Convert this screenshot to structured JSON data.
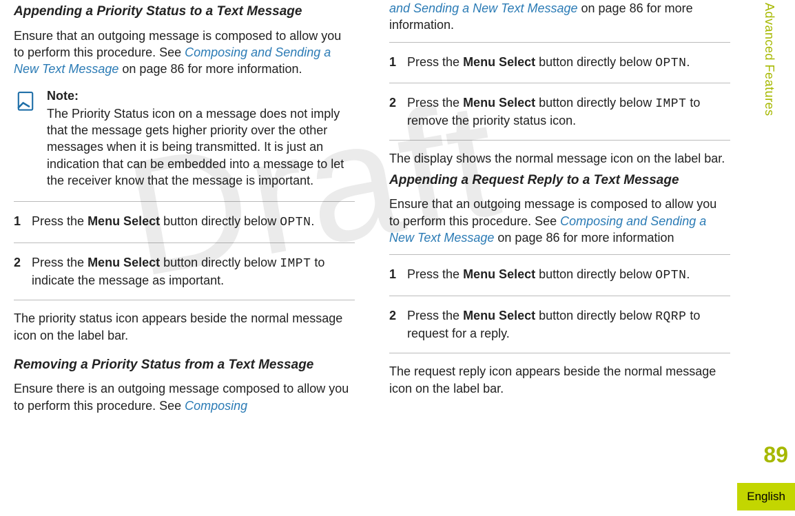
{
  "watermark": "Draft",
  "margin": {
    "chapter": "Advanced Features",
    "pageNumber": "89",
    "language": "English"
  },
  "left": {
    "sec1Heading": "Appending a Priority Status to a Text Message",
    "sec1Intro_a": "Ensure that an outgoing message is composed to allow you to perform this procedure. See ",
    "sec1Intro_link": "Composing and Sending a New Text Message",
    "sec1Intro_b": " on page 86 for more information.",
    "noteTitle": "Note:",
    "noteBody": "The Priority Status icon on a message does not imply that the message gets higher priority over the other messages when it is being transmitted. It is just an indication that can be embedded into a message to let the receiver know that the message is important.",
    "step1Num": "1",
    "step1_a": "Press the ",
    "step1_bold": "Menu Select",
    "step1_b": " button directly below ",
    "step1_code": "OPTN",
    "step1_c": ".",
    "step2Num": "2",
    "step2_a": "Press the ",
    "step2_bold": "Menu Select",
    "step2_b": " button directly below ",
    "step2_code": "IMPT",
    "step2_c": " to indicate the message as important.",
    "sec1Result": "The priority status icon appears beside the normal message icon on the label bar.",
    "sec2Heading": "Removing a Priority Status from a Text Message",
    "sec2Intro_a": "Ensure there is an outgoing message composed to allow you to perform this procedure. See ",
    "sec2Intro_link": "Composing"
  },
  "right": {
    "cont_link": "and Sending a New Text Message",
    "cont_b": " on page 86 for more information.",
    "r1Num": "1",
    "r1_a": "Press the ",
    "r1_bold": "Menu Select",
    "r1_b": " button directly below ",
    "r1_code": "OPTN",
    "r1_c": ".",
    "r2Num": "2",
    "r2_a": "Press the ",
    "r2_bold": "Menu Select",
    "r2_b": " button directly below ",
    "r2_code": "IMPT",
    "r2_c": " to remove the priority status icon.",
    "sec2Result": "The display shows the normal message icon on the label bar.",
    "sec3Heading": "Appending a Request Reply to a Text Message",
    "sec3Intro_a": "Ensure that an outgoing message is composed to allow you to perform this procedure. See ",
    "sec3Intro_link": "Composing and Sending a New Text Message",
    "sec3Intro_b": " on page 86 for more information",
    "r3Num": "1",
    "r3_a": "Press the ",
    "r3_bold": "Menu Select",
    "r3_b": " button directly below ",
    "r3_code": "OPTN",
    "r3_c": ".",
    "r4Num": "2",
    "r4_a": "Press the ",
    "r4_bold": "Menu Select",
    "r4_b": " button directly below ",
    "r4_code": "RQRP",
    "r4_c": " to request for a reply.",
    "sec3Result": "The request reply icon appears beside the normal message icon on the label bar."
  }
}
